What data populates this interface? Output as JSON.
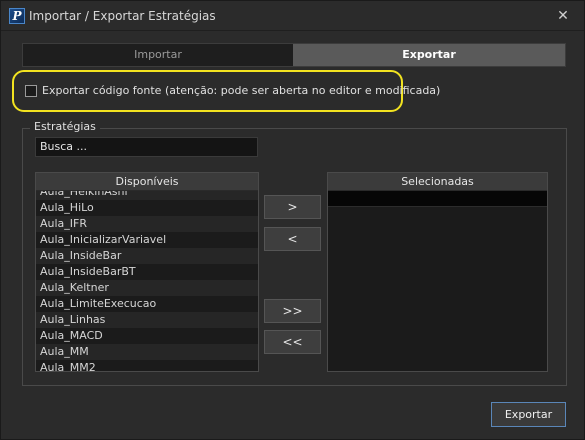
{
  "window": {
    "title": "Importar / Exportar Estratégias",
    "app_icon_letter": "P",
    "close_glyph": "✕"
  },
  "tabs": [
    {
      "label": "Importar",
      "active": false
    },
    {
      "label": "Exportar",
      "active": true
    }
  ],
  "export_source": {
    "checked": false,
    "label": "Exportar código fonte (atenção: pode ser aberta no editor e modificada)"
  },
  "strategies": {
    "group_title": "Estratégias",
    "search_value": "Busca ...",
    "available_header": "Disponíveis",
    "selected_header": "Selecionadas",
    "available_items": [
      "Aula_HeikinAshi",
      "Aula_HiLo",
      "Aula_IFR",
      "Aula_InicializarVariavel",
      "Aula_InsideBar",
      "Aula_InsideBarBT",
      "Aula_Keltner",
      "Aula_LimiteExecucao",
      "Aula_Linhas",
      "Aula_MACD",
      "Aula_MM",
      "Aula_MM2"
    ],
    "selected_items": [
      ""
    ]
  },
  "buttons": {
    "add_one": ">",
    "remove_one": "<",
    "add_all": ">>",
    "remove_all": "<<",
    "export": "Exportar"
  },
  "colors": {
    "highlight_border": "#f2e320",
    "export_button_border": "#5a86b8"
  },
  "icons": {
    "app": "profit-app-icon",
    "close": "close-icon"
  }
}
